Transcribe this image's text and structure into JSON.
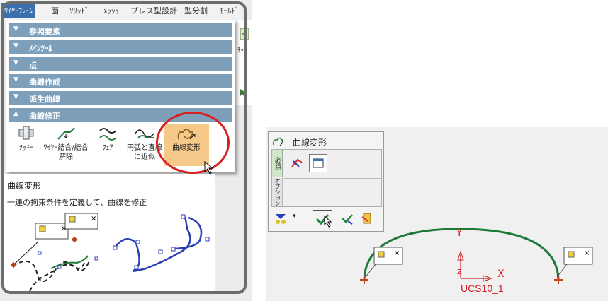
{
  "tabs": [
    {
      "label": "ﾜｲﾔｰﾌﾚｰﾑ",
      "active": true
    },
    {
      "label": "面"
    },
    {
      "label": "ｿﾘｯﾄﾞ"
    },
    {
      "label": "ﾒｯｼｭ"
    },
    {
      "label": "プレス型設計"
    },
    {
      "label": "型分割"
    },
    {
      "label": "ﾓｰﾙﾄﾞ"
    }
  ],
  "categories": [
    {
      "label": "参照要素",
      "expanded": false
    },
    {
      "label": "ﾒｲﾝﾂｰﾙ",
      "expanded": false
    },
    {
      "label": "点",
      "expanded": false
    },
    {
      "label": "曲線作成",
      "expanded": false
    },
    {
      "label": "派生曲線",
      "expanded": false
    },
    {
      "label": "曲線修正",
      "expanded": true
    }
  ],
  "tools": [
    {
      "label": "ｸｯｷｰ",
      "icon": "cookie-icon"
    },
    {
      "label": "ﾜｲﾔｰ結合/結合解除",
      "icon": "wire-join-icon"
    },
    {
      "label": "ﾌｪｱ",
      "icon": "fair-icon"
    },
    {
      "label": "円弧と直線に近似",
      "icon": "arc-line-approx-icon"
    },
    {
      "label": "曲線変形",
      "icon": "curve-deform-icon",
      "highlighted": true
    }
  ],
  "side_label": "ﾁｬ",
  "help": {
    "title": "曲線変形",
    "description": "一連の拘束条件を定義して、曲線を修正"
  },
  "dialog": {
    "title": "曲線変形",
    "side_tabs": [
      "必須",
      "オプション"
    ]
  },
  "viewport": {
    "axis_x": "X",
    "axis_y": "Y",
    "axis_z": "Z",
    "ucs_label": "UCS10_1"
  },
  "colors": {
    "accent": "#3b6fae",
    "category": "#7e9fba",
    "highlight": "#f6c98a",
    "circle": "#d42020",
    "curve_green": "#1f7a3a",
    "curve_blue": "#2a3fb8",
    "ucs_red": "#d02020"
  }
}
